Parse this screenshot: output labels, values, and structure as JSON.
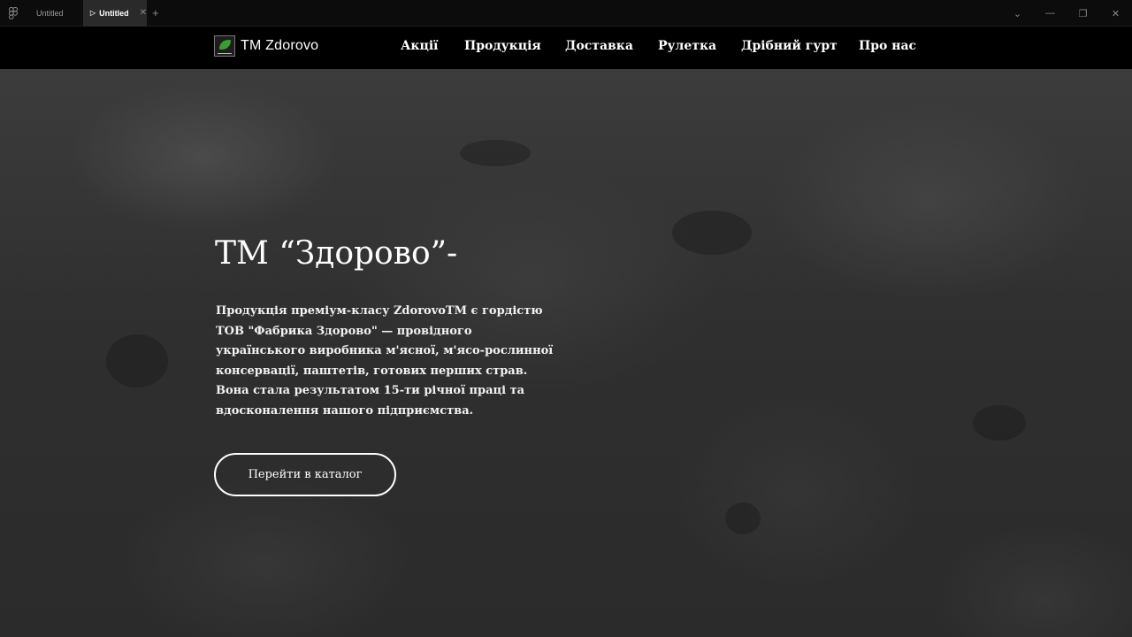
{
  "chrome": {
    "app_icon": "figma-icon",
    "tabs": [
      {
        "label": "Untitled",
        "active": false
      },
      {
        "label": "Untitled",
        "active": true,
        "icon": "play-icon"
      }
    ],
    "add_tab": "+",
    "controls": {
      "dropdown": "⌄",
      "minimize": "—",
      "restore": "❐",
      "close": "✕"
    }
  },
  "header": {
    "logo_text": "TM Zdorovo",
    "nav": [
      "Акції",
      "Продукція",
      "Доставка",
      "Рулетка",
      "Дрібний гурт",
      "Про нас"
    ]
  },
  "hero": {
    "title": "ТМ “Здорово”-",
    "description": "Продукція преміум-класу ZdorovoTM є гордістю ТОВ \"Фабрика Здорово\" — провідного українського виробника м'ясної, м'ясо-рослинної консервації, паштетів, готових перших страв. Вона стала результатом 15-ти річної праці та вдосконалення нашого підприємства.",
    "button_label": "Перейти в каталог"
  },
  "colors": {
    "header_bg": "#000000",
    "hero_bg": "#333333",
    "logo_leaf": "#3e9a35",
    "text": "#ffffff"
  }
}
